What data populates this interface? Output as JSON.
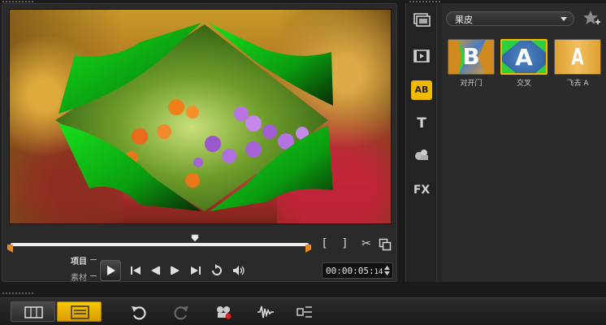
{
  "player": {
    "mode_project": "项目",
    "mode_clip": "素材",
    "timecode": "00:00:05:",
    "timecode_frames": "14"
  },
  "library": {
    "category": "果皮",
    "thumbnails": [
      {
        "letter": "B",
        "label": "对开门"
      },
      {
        "letter": "A",
        "label": "交叉"
      },
      {
        "letter": "A",
        "label": "飞去 A"
      }
    ],
    "tabs": [
      {
        "icon": "media-icon"
      },
      {
        "icon": "instant-project-icon"
      },
      {
        "icon": "transition-icon",
        "label": "AB"
      },
      {
        "icon": "title-icon",
        "label": "T"
      },
      {
        "icon": "graphic-icon"
      },
      {
        "icon": "filter-icon",
        "label": "FX"
      }
    ]
  },
  "colors": {
    "accent": "#f0b800",
    "trim_marker": "#e88a1c",
    "peel_green": "#12c21a"
  }
}
